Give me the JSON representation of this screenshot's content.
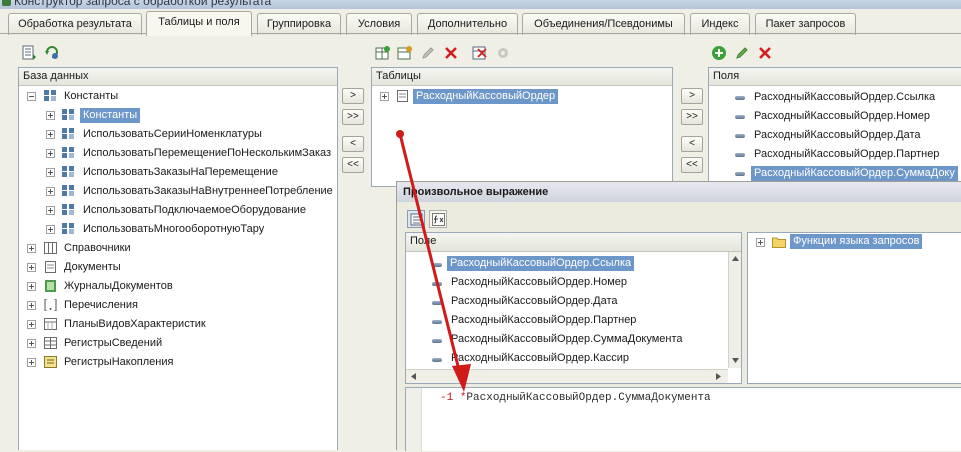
{
  "window": {
    "title": "Конструктор запроса с обработкой результата"
  },
  "tabs": [
    "Обработка результата",
    "Таблицы и поля",
    "Группировка",
    "Условия",
    "Дополнительно",
    "Объединения/Псевдонимы",
    "Индекс",
    "Пакет запросов"
  ],
  "database": {
    "header": "База данных",
    "root": "Константы",
    "constants": [
      "Константы",
      "ИспользоватьСерииНоменклатуры",
      "ИспользоватьПеремещениеПоНесколькимЗаказ",
      "ИспользоватьЗаказыНаПеремещение",
      "ИспользоватьЗаказыНаВнутреннееПотребление",
      "ИспользоватьПодключаемоеОборудование",
      "ИспользоватьМногооборотнуюТару"
    ],
    "groups": [
      "Справочники",
      "Документы",
      "ЖурналыДокументов",
      "Перечисления",
      "ПланыВидовХарактеристик",
      "РегистрыСведений",
      "РегистрыНакопления"
    ]
  },
  "move_buttons": {
    "add": ">",
    "add_all": ">>",
    "remove": "<",
    "remove_all": "<<"
  },
  "tables": {
    "header": "Таблицы",
    "items": [
      "РасходныйКассовыйОрдер"
    ]
  },
  "fields": {
    "header": "Поля",
    "items": [
      "РасходныйКассовыйОрдер.Ссылка",
      "РасходныйКассовыйОрдер.Номер",
      "РасходныйКассовыйОрдер.Дата",
      "РасходныйКассовыйОрдер.Партнер",
      "РасходныйКассовыйОрдер.СуммаДоку"
    ]
  },
  "expression_dialog": {
    "title": "Произвольное выражение",
    "field_header": "Поле",
    "fields": [
      "РасходныйКассовыйОрдер.Ссылка",
      "РасходныйКассовыйОрдер.Номер",
      "РасходныйКассовыйОрдер.Дата",
      "РасходныйКассовыйОрдер.Партнер",
      "РасходныйКассовыйОрдер.СуммаДокумента",
      "РасходныйКассовыйОрдер.Кассир"
    ],
    "functions_label": "Функции языка запросов",
    "expression": {
      "number": "-1",
      "operator": "*",
      "operand": "РасходныйКассовыйОрдер.СуммаДокумента"
    }
  },
  "colors": {
    "selection": "#6e97c9",
    "arrow": "#d11a1a",
    "number": "#c4161c",
    "operand": "#2c2c2c"
  },
  "icons": [
    "toolbar-list-icon",
    "toolbar-refresh-icon",
    "add-icon",
    "edit-icon",
    "delete-icon",
    "folder-icon",
    "field-icon",
    "table-icon"
  ]
}
